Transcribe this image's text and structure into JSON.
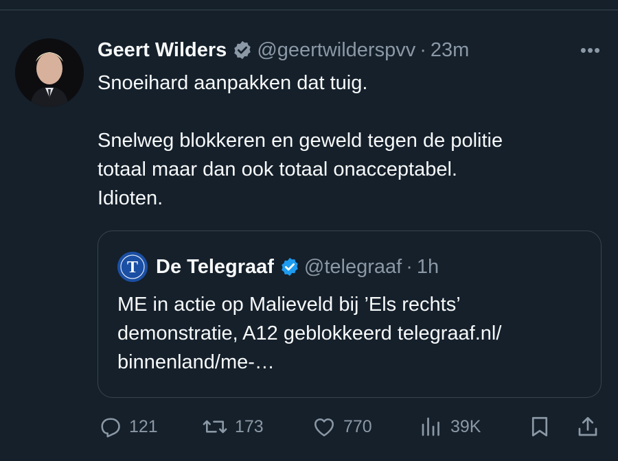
{
  "tweet": {
    "author_name": "Geert Wilders",
    "handle": "@geertwilderspvv",
    "separator": "·",
    "time": "23m",
    "more_label": "•••",
    "text_lines": [
      "Snoeihard aanpakken dat tuig.",
      "Snelweg blokkeren en geweld tegen de politie",
      "totaal maar dan ook totaal onacceptabel.",
      "Idioten."
    ]
  },
  "quote": {
    "author_name": "De Telegraaf",
    "handle": "@telegraaf",
    "separator": "·",
    "time": "1h",
    "logo_letter": "T",
    "text_lines": [
      "ME in actie op Malieveld bij ’Els rechts’",
      "demonstratie, A12 geblokkeerd telegraaf.nl/",
      "binnenland/me-…"
    ]
  },
  "actions": {
    "replies": "121",
    "reposts": "173",
    "likes": "770",
    "views": "39K"
  },
  "colors": {
    "background": "#15202b",
    "text": "#f7f9f9",
    "secondary": "#8b98a5",
    "verified": "#1d9bf0",
    "border": "#38444d"
  }
}
